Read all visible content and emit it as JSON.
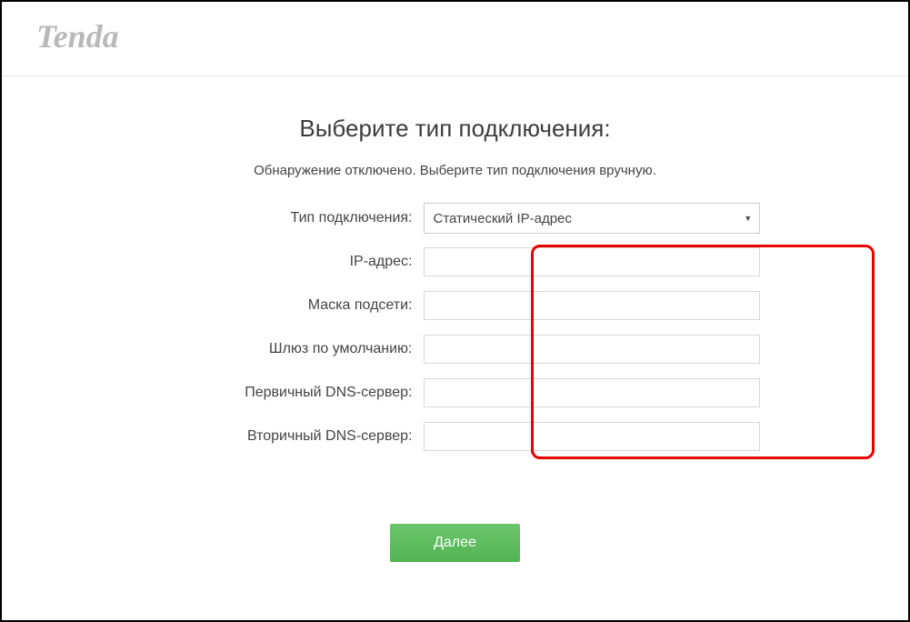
{
  "brand": "Tenda",
  "page": {
    "title": "Выберите тип подключения:",
    "subtitle": "Обнаружение отключено. Выберите тип подключения вручную."
  },
  "form": {
    "connection_type_label": "Тип подключения:",
    "connection_type_value": "Статический IP-адрес",
    "ip_address_label": "IP-адрес:",
    "ip_address_value": "",
    "subnet_mask_label": "Маска подсети:",
    "subnet_mask_value": "",
    "default_gateway_label": "Шлюз по умолчанию:",
    "default_gateway_value": "",
    "primary_dns_label": "Первичный DNS-сервер:",
    "primary_dns_value": "",
    "secondary_dns_label": "Вторичный DNS-сервер:",
    "secondary_dns_value": ""
  },
  "actions": {
    "next_label": "Далее"
  },
  "colors": {
    "highlight": "#e60000",
    "primary_button": "#5cb85c"
  }
}
